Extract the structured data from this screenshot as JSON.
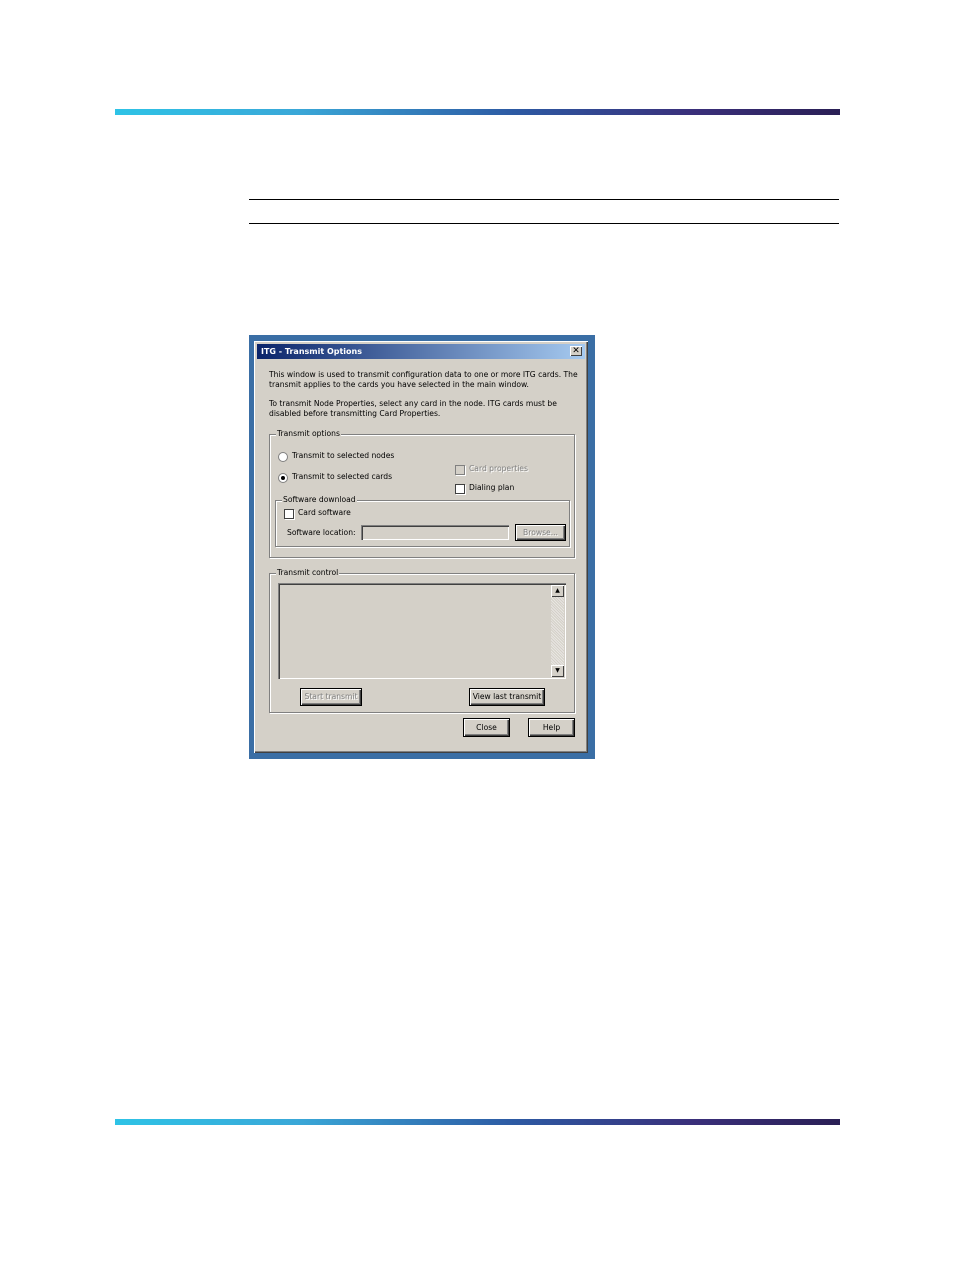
{
  "dialog": {
    "title": "ITG - Transmit Options",
    "close_glyph": "✕",
    "intro_line1": "This window is used to transmit configuration data to one or more ITG cards.  The",
    "intro_line2": "transmit applies to the cards you have selected in the main window.",
    "note_line1": "To transmit Node Properties, select any card in the node. ITG cards must be",
    "note_line2": "disabled before transmitting Card Properties."
  },
  "transmit_options": {
    "legend": "Transmit options",
    "radio_nodes": "Transmit to selected nodes",
    "radio_cards": "Transmit to selected cards",
    "card_properties": "Card properties",
    "dialing_plan": "Dialing plan",
    "software_download": {
      "legend": "Software download",
      "card_software": "Card software",
      "location_label": "Software location:",
      "location_value": "",
      "browse": "Browse..."
    }
  },
  "transmit_control": {
    "legend": "Transmit control",
    "start": "Start transmit",
    "view_last": "View last transmit"
  },
  "buttons": {
    "close": "Close",
    "help": "Help"
  }
}
